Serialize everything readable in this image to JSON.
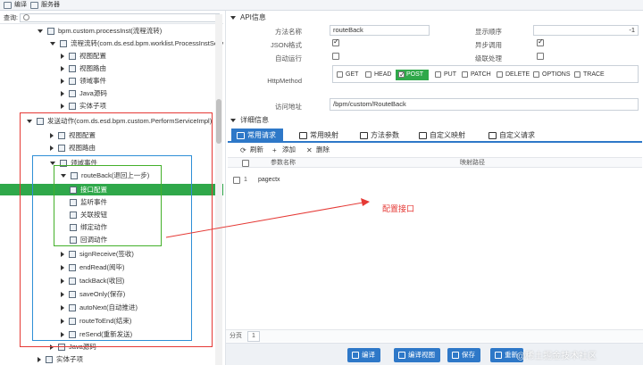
{
  "topbar": {
    "compile": "编译",
    "server": "服务器"
  },
  "search": {
    "label": "查询:",
    "value": ""
  },
  "tree": [
    {
      "label": "bpm.custom.processInst(流程流转)"
    },
    {
      "label": "流程流转(com.ds.esd.bpm.worklist.ProcessInstService"
    },
    {
      "label": "视图配置"
    },
    {
      "label": "视图路由"
    },
    {
      "label": "领域事件"
    },
    {
      "label": "Java源码"
    },
    {
      "label": "实体子项"
    },
    {
      "label": "发送动作(com.ds.esd.bpm.custom.PerformServiceImpl)"
    },
    {
      "label": "视图配置"
    },
    {
      "label": "视图路由"
    },
    {
      "label": "领域事件"
    },
    {
      "label": "routeBack(退回上一步)"
    },
    {
      "label": "接口配置"
    },
    {
      "label": "监听事件"
    },
    {
      "label": "关联按钮"
    },
    {
      "label": "绑定动作"
    },
    {
      "label": "回调动作"
    },
    {
      "label": "signReceive(签收)"
    },
    {
      "label": "endRead(阅毕)"
    },
    {
      "label": "tackBack(收回)"
    },
    {
      "label": "saveOnly(保存)"
    },
    {
      "label": "autoNext(自动推进)"
    },
    {
      "label": "routeToEnd(结束)"
    },
    {
      "label": "reSend(重新发送)"
    },
    {
      "label": "Java源码"
    },
    {
      "label": "实体子项"
    }
  ],
  "api": {
    "section_title": "API信息",
    "method_name_label": "方法名称",
    "method_name_value": "routeBack",
    "display_order_label": "显示顺序",
    "display_order_value": "-1",
    "json_label": "JSON格式",
    "async_label": "异步调用",
    "auto_run_label": "自动运行",
    "batch_label": "级联处理",
    "http_method_label": "HttpMethod",
    "http_methods": [
      "GET",
      "HEAD",
      "POST",
      "PUT",
      "PATCH",
      "DELETE",
      "OPTIONS",
      "TRACE"
    ],
    "url_label": "访问地址",
    "url_value": "/bpm/custom/RouteBack"
  },
  "detail": {
    "section_title": "详细信息",
    "tabs": [
      "常用请求",
      "常用映射",
      "方法参数",
      "自定义映射",
      "自定义请求"
    ],
    "toolbar": {
      "refresh": "刷新",
      "add": "添加",
      "delete": "删除"
    },
    "columns": [
      "参数名称",
      "映射路径"
    ],
    "rows": [
      {
        "index": "1",
        "name": "pagectx",
        "path": ""
      }
    ],
    "pager_label": "分页",
    "pager_value": "1"
  },
  "footer": {
    "compile": "编译",
    "compile_view": "编译视图",
    "save": "保存",
    "reset": "重新"
  },
  "annotation": "配置接口",
  "watermark": "@稀土掘金技术社区",
  "colors": {
    "selected": "#2fa84a",
    "primary": "#2e78c8",
    "red_box": "#e53935",
    "blue_box": "#2e8fd6",
    "green_box": "#43b02a"
  }
}
